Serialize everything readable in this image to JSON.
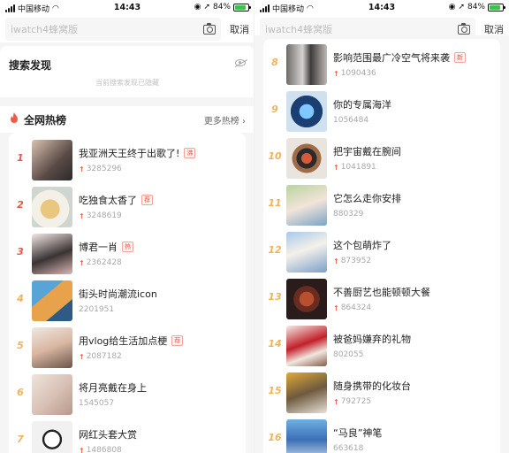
{
  "status_bars": [
    {
      "carrier": "中国移动",
      "time": "14:43",
      "battery": "84%"
    },
    {
      "carrier": "中国移动",
      "time": "14:43",
      "battery": "84%"
    }
  ],
  "search": {
    "placeholder": "iwatch4蜂窝版",
    "cancel_label": "取消"
  },
  "discover": {
    "title": "搜索发现",
    "hidden_note": "当前搜索发现已隐藏"
  },
  "hot": {
    "title": "全网热榜",
    "more_label": "更多热榜 ›"
  },
  "colors": {
    "accent_red": "#ef5b4b",
    "rank_top": "#e8554a",
    "rank_other": "#f0b35a"
  },
  "items": [
    {
      "rank": "1",
      "title": "我亚洲天王终于出歌了!",
      "badge": "沸",
      "count": "3285296",
      "rising": true
    },
    {
      "rank": "2",
      "title": "吃独食太香了",
      "badge": "荐",
      "count": "3248619",
      "rising": true
    },
    {
      "rank": "3",
      "title": "博君一肖",
      "badge": "热",
      "count": "2362428",
      "rising": true
    },
    {
      "rank": "4",
      "title": "街头时尚潮流icon",
      "badge": "",
      "count": "2201951",
      "rising": false
    },
    {
      "rank": "5",
      "title": "用vlog给生活加点梗",
      "badge": "荐",
      "count": "2087182",
      "rising": true
    },
    {
      "rank": "6",
      "title": "将月亮戴在身上",
      "badge": "",
      "count": "1545057",
      "rising": false
    },
    {
      "rank": "7",
      "title": "网红头套大赏",
      "badge": "",
      "count": "1486808",
      "rising": true
    },
    {
      "rank": "8",
      "title": "影响范围最广冷空气将来袭",
      "badge": "新",
      "count": "1090436",
      "rising": true
    },
    {
      "rank": "9",
      "title": "你的专属海洋",
      "badge": "",
      "count": "1056484",
      "rising": false
    },
    {
      "rank": "10",
      "title": "把宇宙戴在腕间",
      "badge": "",
      "count": "1041891",
      "rising": true
    },
    {
      "rank": "11",
      "title": "它怎么走你安排",
      "badge": "",
      "count": "880329",
      "rising": false
    },
    {
      "rank": "12",
      "title": "这个包萌炸了",
      "badge": "",
      "count": "873952",
      "rising": true
    },
    {
      "rank": "13",
      "title": "不善厨艺也能顿顿大餐",
      "badge": "",
      "count": "864324",
      "rising": true
    },
    {
      "rank": "14",
      "title": "被爸妈嫌弃的礼物",
      "badge": "",
      "count": "802055",
      "rising": false
    },
    {
      "rank": "15",
      "title": "随身携带的化妆台",
      "badge": "",
      "count": "792725",
      "rising": true
    },
    {
      "rank": "16",
      "title": "“马良”神笔",
      "badge": "",
      "count": "663618",
      "rising": false
    }
  ]
}
